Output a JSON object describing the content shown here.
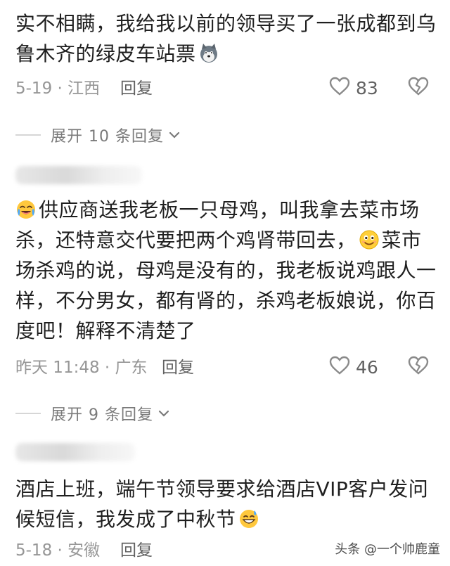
{
  "comments": [
    {
      "text_parts": [
        "实不相瞒，我给我以前的领导买了一张成都到乌鲁木齐的绿皮车站票"
      ],
      "date": "5-19 · 江西",
      "reply_label": "回复",
      "likes": "83",
      "emoji_icon": "husky-dog-icon"
    },
    {
      "text_parts": [
        "供应商送我老板一只母鸡，叫我拿去菜市场杀，还特意交代要把两个鸡肾带回去，",
        "菜市场杀鸡的说，母鸡是没有的，我老板说鸡跟人一样，不分男女，都有肾的，杀鸡老板娘说，你百度吧！解释不清楚了"
      ],
      "date": "昨天 11:48 · 广东",
      "reply_label": "回复",
      "likes": "46",
      "emoji_icons": [
        "crying-laughing-icon",
        "smiling-face-icon"
      ]
    },
    {
      "text_parts": [
        "酒店上班，端午节领导要求给酒店VIP客户发问候短信，我发成了中秋节"
      ],
      "date": "5-18 · 安徽",
      "reply_label": "回复",
      "emoji_icon": "grinning-sweat-icon"
    }
  ],
  "expand_replies": [
    {
      "label": "展开 10 条回复"
    },
    {
      "label": "展开 9 条回复"
    }
  ],
  "watermark": "头条 @一个帅鹿童"
}
